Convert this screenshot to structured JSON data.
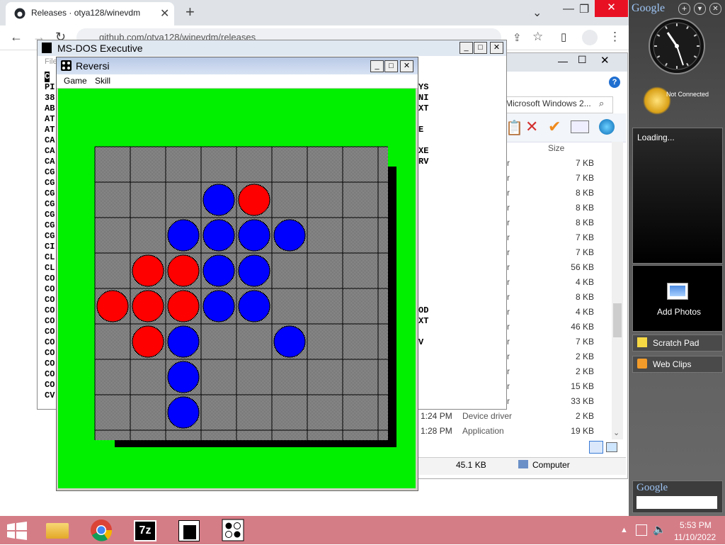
{
  "chrome": {
    "tab_title": "Releases · otya128/winevdm",
    "url": "github.com/otya128/winevdm/releases"
  },
  "msdos": {
    "title": "MS-DOS Executive",
    "menu_partial": "File",
    "left_column": [
      "C",
      "PI",
      "38",
      "AB",
      "AT",
      "AT",
      "CA",
      "CA",
      "CA",
      "CG",
      "CG",
      "CG",
      "CG",
      "CG",
      "CG",
      "CG",
      "CI",
      "CL",
      "CL",
      "CO",
      "CO",
      "CO",
      "CO",
      "CO",
      "CO",
      "CO",
      "CO",
      "CO",
      "CO",
      "CO",
      "CV"
    ],
    "right_column": [
      {
        "row": 1,
        "text": "YS"
      },
      {
        "row": 2,
        "text": "NI"
      },
      {
        "row": 3,
        "text": "XT"
      },
      {
        "row": 5,
        "text": "E"
      },
      {
        "row": 7,
        "text": "XE"
      },
      {
        "row": 8,
        "text": "RV"
      },
      {
        "row": 22,
        "text": "OD"
      },
      {
        "row": 23,
        "text": "XT"
      },
      {
        "row": 25,
        "text": "V"
      }
    ]
  },
  "reversi": {
    "title": "Reversi",
    "menu": [
      "Game",
      "Skill"
    ],
    "colors": {
      "red": "#ff0000",
      "blue": "#0000ff",
      "field": "#00f000"
    },
    "pieces": [
      {
        "row": 1,
        "col": 3,
        "color": "blue"
      },
      {
        "row": 1,
        "col": 4,
        "color": "red"
      },
      {
        "row": 2,
        "col": 2,
        "color": "blue"
      },
      {
        "row": 2,
        "col": 3,
        "color": "blue"
      },
      {
        "row": 2,
        "col": 4,
        "color": "blue"
      },
      {
        "row": 2,
        "col": 5,
        "color": "blue"
      },
      {
        "row": 3,
        "col": 1,
        "color": "red"
      },
      {
        "row": 3,
        "col": 2,
        "color": "red"
      },
      {
        "row": 3,
        "col": 3,
        "color": "blue"
      },
      {
        "row": 3,
        "col": 4,
        "color": "blue"
      },
      {
        "row": 4,
        "col": 0,
        "color": "red"
      },
      {
        "row": 4,
        "col": 1,
        "color": "red"
      },
      {
        "row": 4,
        "col": 2,
        "color": "red"
      },
      {
        "row": 4,
        "col": 3,
        "color": "blue"
      },
      {
        "row": 4,
        "col": 4,
        "color": "blue"
      },
      {
        "row": 5,
        "col": 1,
        "color": "red"
      },
      {
        "row": 5,
        "col": 2,
        "color": "blue"
      },
      {
        "row": 5,
        "col": 5,
        "color": "blue"
      },
      {
        "row": 6,
        "col": 2,
        "color": "blue"
      },
      {
        "row": 7,
        "col": 2,
        "color": "blue"
      }
    ]
  },
  "explorer": {
    "search_text": "Microsoft Windows 2...",
    "size_header": "Size",
    "sizes": [
      "7 KB",
      "7 KB",
      "8 KB",
      "8 KB",
      "8 KB",
      "7 KB",
      "7 KB",
      "56 KB",
      "4 KB",
      "8 KB",
      "4 KB",
      "46 KB",
      "7 KB",
      "2 KB",
      "2 KB",
      "15 KB",
      "33 KB",
      "2 KB",
      "19 KB"
    ],
    "partial_type_char": "r",
    "last_rows": [
      {
        "time": "1:24 PM",
        "type": "Device driver",
        "size": "2 KB"
      },
      {
        "time": "1:28 PM",
        "type": "Application",
        "size": "19 KB"
      }
    ],
    "status_size": "45.1 KB",
    "status_location": "Computer"
  },
  "gadgets": {
    "google_logo": "Google",
    "weather_status": "Not Connected",
    "loading_text": "Loading...",
    "photos_label": "Add Photos",
    "scratch_pad": "Scratch Pad",
    "web_clips": "Web Clips",
    "google_search_logo": "Google"
  },
  "taskbar": {
    "time": "5:53 PM",
    "date": "11/10/2022",
    "sevenzip_label": "7z"
  }
}
